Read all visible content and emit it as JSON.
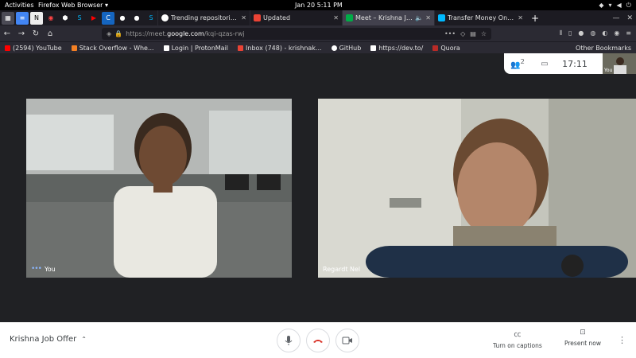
{
  "system_bar": {
    "activities": "Activities",
    "app_menu": "Firefox Web Browser ▾",
    "clock": "Jan 20   5:11 PM"
  },
  "tabs": [
    {
      "title": "Trending repositories o",
      "color": "#ffffff"
    },
    {
      "title": "Updated",
      "color": "#ea4335"
    },
    {
      "title": "Meet – Krishna Job O",
      "color": "#00ac47"
    },
    {
      "title": "Transfer Money Online",
      "color": "#00b9ff"
    }
  ],
  "browser": {
    "url_prefix": "https://meet.",
    "url_domain": "google.com",
    "url_path": "/kqi-qzas-rwj"
  },
  "bookmarks": [
    {
      "label": "(2594) YouTube",
      "color": "#ff0000"
    },
    {
      "label": "Stack Overflow - Whe...",
      "color": "#f48024"
    },
    {
      "label": "Login | ProtonMail",
      "color": "#ffffff"
    },
    {
      "label": "Inbox (748) - krishnak...",
      "color": "#ea4335"
    },
    {
      "label": "GitHub",
      "color": "#ffffff"
    },
    {
      "label": "https://dev.to/",
      "color": "#ffffff"
    },
    {
      "label": "Quora",
      "color": "#b92b27"
    }
  ],
  "other_bookmarks": "Other Bookmarks",
  "meet": {
    "participant_count": "2",
    "time": "17:11",
    "self_label": "You",
    "participants": [
      {
        "name": "You"
      },
      {
        "name": "Regardt Nel"
      }
    ],
    "meeting_title": "Krishna Job Offer",
    "captions_label": "Turn on captions",
    "present_label": "Present now"
  }
}
